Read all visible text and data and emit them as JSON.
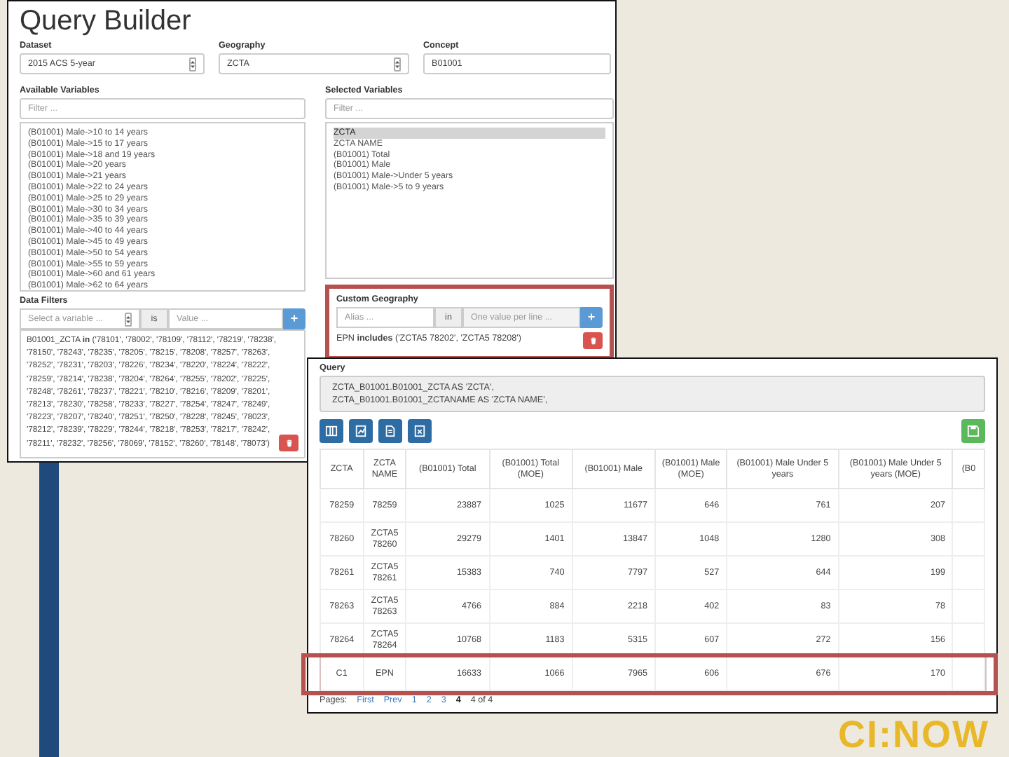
{
  "slide": {
    "logo": "CI:NOW"
  },
  "query_builder": {
    "title": "Query Builder",
    "fields": [
      {
        "label": "Dataset",
        "kind": "select",
        "value": "2015 ACS 5-year"
      },
      {
        "label": "Geography",
        "kind": "select",
        "value": "ZCTA"
      },
      {
        "label": "Concept",
        "kind": "input",
        "value": "B01001"
      }
    ],
    "available_variables": {
      "label": "Available Variables",
      "filter_placeholder": "Filter ...",
      "items": [
        {
          "text": "(B01001) Male->10 to 14 years",
          "selected": false
        },
        {
          "text": "(B01001) Male->15 to 17 years",
          "selected": false
        },
        {
          "text": "(B01001) Male->18 and 19 years",
          "selected": false
        },
        {
          "text": "(B01001) Male->20 years",
          "selected": false
        },
        {
          "text": "(B01001) Male->21 years",
          "selected": false
        },
        {
          "text": "(B01001) Male->22 to 24 years",
          "selected": false
        },
        {
          "text": "(B01001) Male->25 to 29 years",
          "selected": false
        },
        {
          "text": "(B01001) Male->30 to 34 years",
          "selected": false
        },
        {
          "text": "(B01001) Male->35 to 39 years",
          "selected": false
        },
        {
          "text": "(B01001) Male->40 to 44 years",
          "selected": false
        },
        {
          "text": "(B01001) Male->45 to 49 years",
          "selected": false
        },
        {
          "text": "(B01001) Male->50 to 54 years",
          "selected": false
        },
        {
          "text": "(B01001) Male->55 to 59 years",
          "selected": false
        },
        {
          "text": "(B01001) Male->60 and 61 years",
          "selected": false
        },
        {
          "text": "(B01001) Male->62 to 64 years",
          "selected": false
        }
      ]
    },
    "selected_variables": {
      "label": "Selected Variables",
      "filter_placeholder": "Filter ...",
      "items": [
        {
          "text": "ZCTA",
          "selected": true
        },
        {
          "text": "ZCTA NAME",
          "selected": false
        },
        {
          "text": "(B01001) Total",
          "selected": false
        },
        {
          "text": "(B01001) Male",
          "selected": false
        },
        {
          "text": "(B01001) Male->Under 5 years",
          "selected": false
        },
        {
          "text": "(B01001) Male->5 to 9 years",
          "selected": false
        }
      ]
    },
    "data_filters": {
      "label": "Data Filters",
      "variable_placeholder": "Select a variable ...",
      "operator": "is",
      "value_placeholder": "Value ...",
      "add_button": "+",
      "expression": "B01001_ZCTA **in** ('78101', '78002', '78109', '78112', '78219', '78238', '78150', '78243', '78235', '78205', '78215', '78208', '78257', '78263', '78252', '78231', '78203', '78226', '78234', '78220', '78224', '78222', '78259', '78214', '78238', '78204', '78264', '78255', '78202', '78225', '78248', '78261', '78237', '78221', '78210', '78216', '78209', '78201', '78213', '78230', '78258', '78233', '78227', '78254', '78247', '78249', '78223', '78207', '78240', '78251', '78250', '78228', '78245', '78023', '78212', '78239', '78229', '78244', '78218', '78253', '78217', '78242', '78211', '78232', '78256', '78069', '78152', '78260', '78148', '78073')"
    },
    "custom_geography": {
      "label": "Custom Geography",
      "highlighted": true,
      "alias_placeholder": "Alias ...",
      "operator": "in",
      "values_placeholder": "One value per line ...",
      "add_button": "+",
      "definition": "EPN **includes** ('ZCTA5 78202', 'ZCTA5 78208')"
    }
  },
  "results": {
    "query_label": "Query",
    "query_lines": [
      "ZCTA_B01001.B01001_ZCTA AS 'ZCTA',",
      "ZCTA_B01001.B01001_ZCTANAME AS 'ZCTA NAME',"
    ],
    "columns": [
      "ZCTA",
      "ZCTA NAME",
      "(B01001) Total",
      "(B01001) Total (MOE)",
      "(B01001) Male",
      "(B01001) Male (MOE)",
      "(B01001) Male Under 5 years",
      "(B01001) Male Under 5 years (MOE)",
      "(B0"
    ],
    "rows": [
      {
        "highlighted": false,
        "cells": [
          "78259",
          "78259",
          "23887",
          "1025",
          "11677",
          "646",
          "761",
          "207"
        ]
      },
      {
        "highlighted": false,
        "cells": [
          "78260",
          "ZCTA5 78260",
          "29279",
          "1401",
          "13847",
          "1048",
          "1280",
          "308"
        ]
      },
      {
        "highlighted": false,
        "cells": [
          "78261",
          "ZCTA5 78261",
          "15383",
          "740",
          "7797",
          "527",
          "644",
          "199"
        ]
      },
      {
        "highlighted": false,
        "cells": [
          "78263",
          "ZCTA5 78263",
          "4766",
          "884",
          "2218",
          "402",
          "83",
          "78"
        ]
      },
      {
        "highlighted": false,
        "cells": [
          "78264",
          "ZCTA5 78264",
          "10768",
          "1183",
          "5315",
          "607",
          "272",
          "156"
        ]
      },
      {
        "highlighted": true,
        "cells": [
          "C1",
          "EPN",
          "16633",
          "1066",
          "7965",
          "606",
          "676",
          "170"
        ]
      }
    ],
    "pagination": {
      "label": "Pages:",
      "links": [
        {
          "text": "First",
          "selected": false
        },
        {
          "text": "Prev",
          "selected": false
        },
        {
          "text": "1",
          "selected": false
        },
        {
          "text": "2",
          "selected": false
        },
        {
          "text": "3",
          "selected": false
        },
        {
          "text": "4",
          "selected": true
        }
      ],
      "summary": "4 of 4"
    }
  }
}
